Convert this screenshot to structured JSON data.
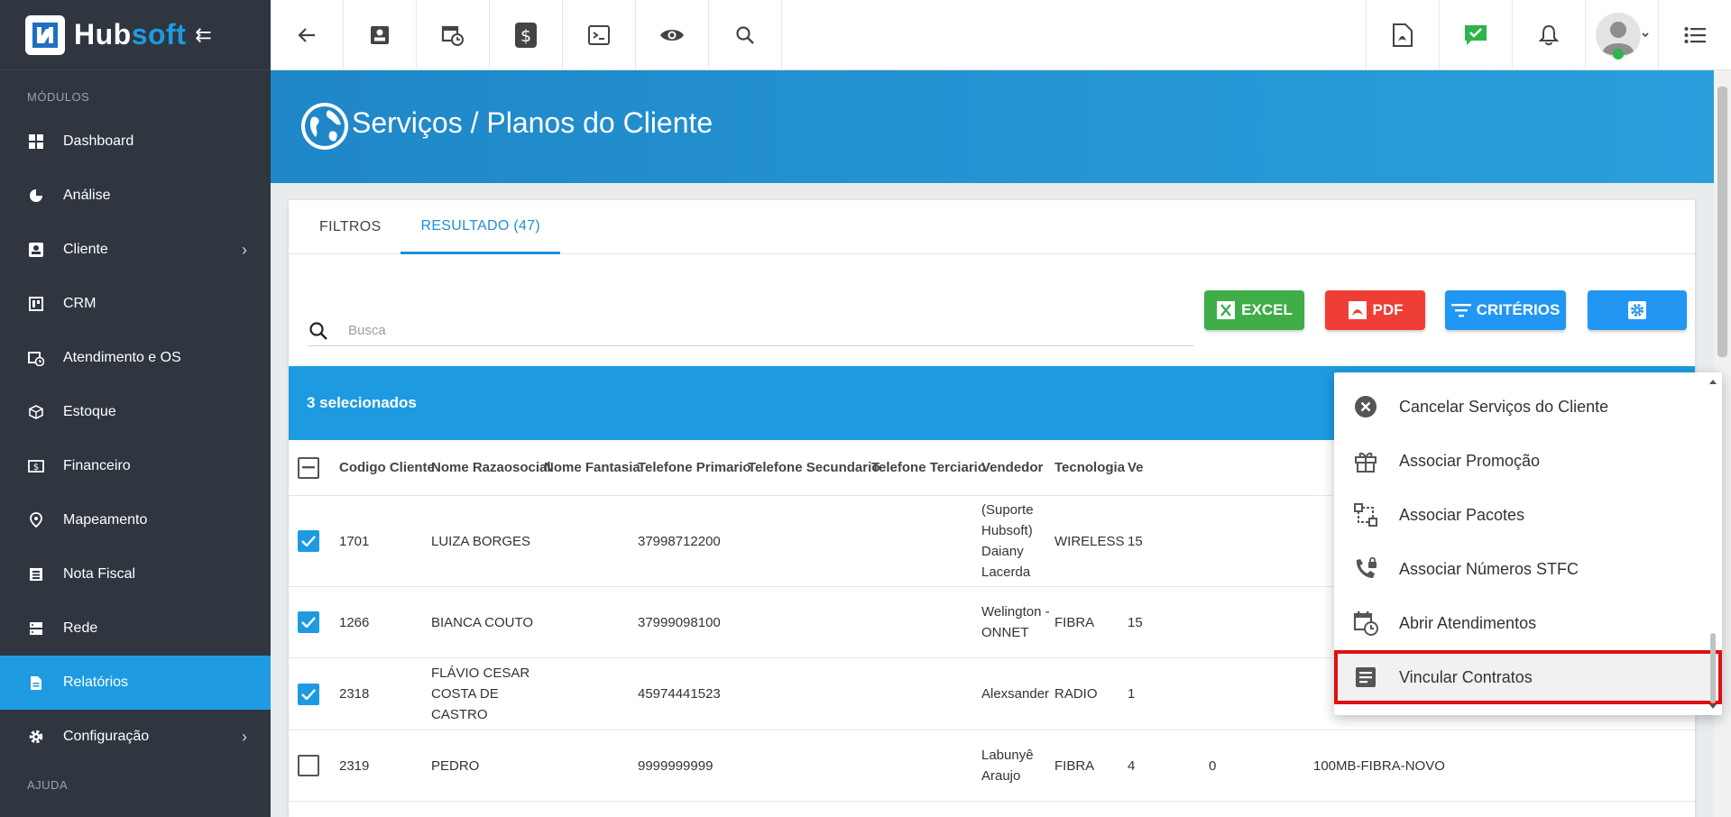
{
  "sidebar": {
    "brand_hub": "Hub",
    "brand_soft": "soft",
    "modules_title": "MÓDULOS",
    "help_title": "AJUDA",
    "items": [
      {
        "label": "Dashboard",
        "icon": "dashboard-icon"
      },
      {
        "label": "Análise",
        "icon": "pie-chart-icon"
      },
      {
        "label": "Cliente",
        "icon": "contact-card-icon",
        "chevron": true
      },
      {
        "label": "CRM",
        "icon": "board-icon"
      },
      {
        "label": "Atendimento e OS",
        "icon": "calendar-clock-icon"
      },
      {
        "label": "Estoque",
        "icon": "box-icon"
      },
      {
        "label": "Financeiro",
        "icon": "money-icon"
      },
      {
        "label": "Mapeamento",
        "icon": "location-pin-icon"
      },
      {
        "label": "Nota Fiscal",
        "icon": "document-list-icon"
      },
      {
        "label": "Rede",
        "icon": "server-icon"
      },
      {
        "label": "Relatórios",
        "icon": "report-icon",
        "active": true
      },
      {
        "label": "Configuração",
        "icon": "gear-icon",
        "chevron": true
      }
    ]
  },
  "header": {
    "title": "Serviços / Planos do Cliente"
  },
  "tabs": [
    {
      "label": "FILTROS"
    },
    {
      "label": "RESULTADO (47)",
      "active": true
    }
  ],
  "search": {
    "placeholder": "Busca"
  },
  "actions": {
    "excel": "EXCEL",
    "pdf": "PDF",
    "criteria": "CRITÉRIOS"
  },
  "selection": {
    "text": "3 selecionados"
  },
  "table": {
    "columns": [
      "Codigo Cliente",
      "Nome Razaosocial",
      "Nome Fantasia",
      "Telefone Primario",
      "Telefone Secundario",
      "Telefone Terciario",
      "Vendedor",
      "Tecnologia",
      "Ve"
    ],
    "rows": [
      {
        "checked": true,
        "codigo": "1701",
        "nome": "LUIZA BORGES",
        "fantasia": "",
        "tel1": "37998712200",
        "tel2": "",
        "tel3": "",
        "vendedor": "(Suporte Hubsoft) Daiany Lacerda",
        "tecnologia": "WIRELESS",
        "ve": "15",
        "extra1": "",
        "extra2": ""
      },
      {
        "checked": true,
        "codigo": "1266",
        "nome": "BIANCA COUTO",
        "fantasia": "",
        "tel1": "37999098100",
        "tel2": "",
        "tel3": "",
        "vendedor": "Welington - ONNET",
        "tecnologia": "FIBRA",
        "ve": "15",
        "extra1": "",
        "extra2": ""
      },
      {
        "checked": true,
        "codigo": "2318",
        "nome": "FLÁVIO CESAR COSTA DE CASTRO",
        "fantasia": "",
        "tel1": "45974441523",
        "tel2": "",
        "tel3": "",
        "vendedor": "Alexsander",
        "tecnologia": "RADIO",
        "ve": "1",
        "extra1": "",
        "extra2": ""
      },
      {
        "checked": false,
        "codigo": "2319",
        "nome": "PEDRO",
        "fantasia": "",
        "tel1": "9999999999",
        "tel2": "",
        "tel3": "",
        "vendedor": "Labunyê Araujo",
        "tecnologia": "FIBRA",
        "ve": "4",
        "extra1": "0",
        "extra2": "100MB-FIBRA-NOVO"
      }
    ]
  },
  "menu": {
    "items": [
      {
        "label": "Cancelar Serviços do Cliente",
        "icon": "cancel-circle-icon"
      },
      {
        "label": "Associar Promoção",
        "icon": "gift-icon"
      },
      {
        "label": "Associar Pacotes",
        "icon": "package-link-icon"
      },
      {
        "label": "Associar Números STFC",
        "icon": "phone-lock-icon"
      },
      {
        "label": "Abrir Atendimentos",
        "icon": "calendar-clock-icon"
      },
      {
        "label": "Vincular Contratos",
        "icon": "contract-icon",
        "highlight": true
      }
    ]
  },
  "colors": {
    "sidebar_bg": "#2f3640",
    "accent": "#1e9be0",
    "excel": "#3fae49",
    "pdf": "#ef3e36",
    "highlight_border": "#e01010"
  }
}
